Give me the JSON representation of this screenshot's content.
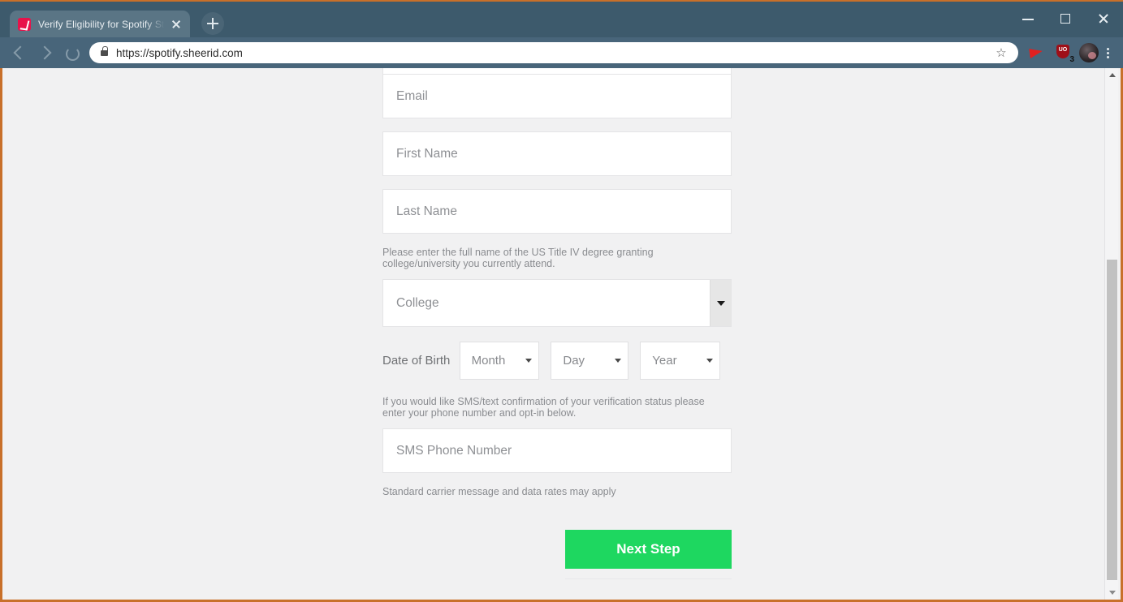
{
  "browser": {
    "tab": {
      "title": "Verify Eligibility for Spotify Stude",
      "favicon_name": "sheerid-logo-icon",
      "close_label": "×"
    },
    "new_tab_label": "+",
    "window_controls": {
      "minimize": "−",
      "maximize": "□",
      "close": "×"
    },
    "nav": {
      "back": "←",
      "forward": "→",
      "reload": "↻"
    },
    "address": {
      "url": "https://spotify.sheerid.com",
      "lock_icon": "lock-icon",
      "bookmark_icon": "☆"
    },
    "extensions": [
      {
        "name": "red-bird-extension-icon",
        "label": ""
      },
      {
        "name": "uo-shield-extension-icon",
        "label": "UO",
        "badge": "3"
      }
    ],
    "profile": {
      "name": "profile-avatar"
    },
    "menu": "⋮"
  },
  "page": {
    "fields": {
      "email_placeholder": "Email",
      "first_name_placeholder": "First Name",
      "last_name_placeholder": "Last Name",
      "college_placeholder": "College",
      "sms_placeholder": "SMS Phone Number"
    },
    "helper_college": "Please enter the full name of the US Title IV degree granting college/university you currently attend.",
    "helper_sms": "If you would like SMS/text confirmation of your verification status please enter your phone number and opt-in below.",
    "note_carrier": "Standard carrier message and data rates may apply",
    "date_of_birth": {
      "label": "Date of Birth",
      "month_placeholder": "Month",
      "day_placeholder": "Day",
      "year_placeholder": "Year"
    },
    "submit_label": "Next Step"
  },
  "colors": {
    "accent_green": "#1ED760",
    "chrome": "#3D5A6C",
    "page_bg": "#F1F1F2",
    "frame_border": "#C8702A"
  }
}
